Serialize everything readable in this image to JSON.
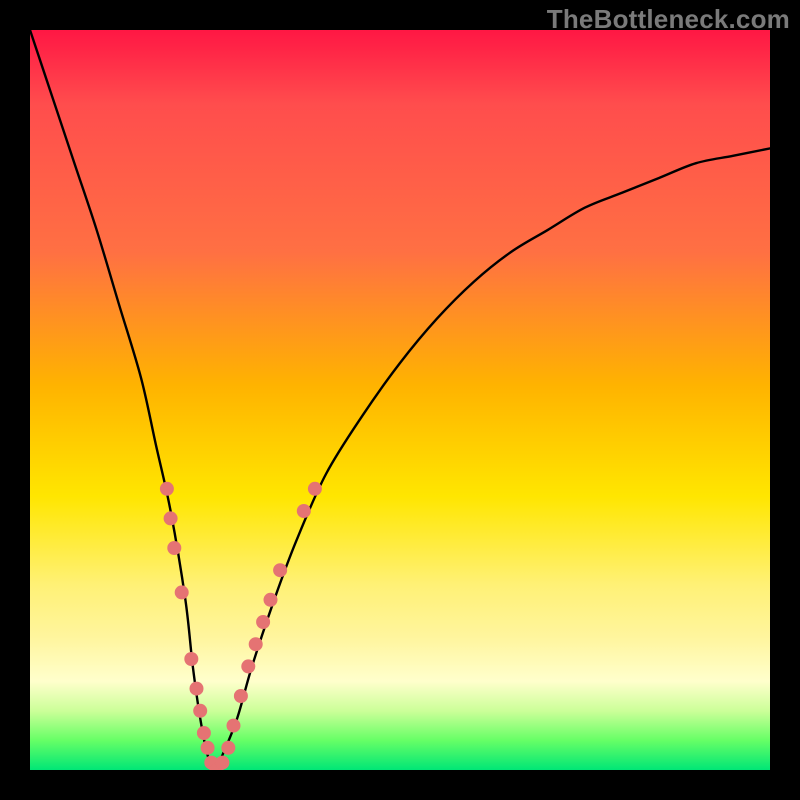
{
  "watermark": "TheBottleneck.com",
  "chart_data": {
    "type": "line",
    "title": "",
    "xlabel": "",
    "ylabel": "",
    "xlim": [
      0,
      100
    ],
    "ylim": [
      0,
      100
    ],
    "grid": false,
    "series": [
      {
        "name": "bottleneck-curve",
        "x": [
          0,
          3,
          6,
          9,
          12,
          15,
          17,
          19,
          21,
          22,
          23,
          24,
          25,
          26,
          28,
          30,
          33,
          36,
          40,
          45,
          50,
          55,
          60,
          65,
          70,
          75,
          80,
          85,
          90,
          95,
          100
        ],
        "values": [
          100,
          91,
          82,
          73,
          63,
          53,
          44,
          35,
          23,
          14,
          7,
          2,
          0,
          2,
          7,
          14,
          23,
          31,
          40,
          48,
          55,
          61,
          66,
          70,
          73,
          76,
          78,
          80,
          82,
          83,
          84
        ],
        "color": "#000000"
      }
    ],
    "markers": {
      "name": "sample-points",
      "color": "#e57373",
      "points": [
        {
          "x": 18.5,
          "y": 38
        },
        {
          "x": 19.0,
          "y": 34
        },
        {
          "x": 19.5,
          "y": 30
        },
        {
          "x": 20.5,
          "y": 24
        },
        {
          "x": 21.8,
          "y": 15
        },
        {
          "x": 22.5,
          "y": 11
        },
        {
          "x": 23.0,
          "y": 8
        },
        {
          "x": 23.5,
          "y": 5
        },
        {
          "x": 24.0,
          "y": 3
        },
        {
          "x": 24.5,
          "y": 1
        },
        {
          "x": 25.2,
          "y": 0
        },
        {
          "x": 26.0,
          "y": 1
        },
        {
          "x": 26.8,
          "y": 3
        },
        {
          "x": 27.5,
          "y": 6
        },
        {
          "x": 28.5,
          "y": 10
        },
        {
          "x": 29.5,
          "y": 14
        },
        {
          "x": 30.5,
          "y": 17
        },
        {
          "x": 31.5,
          "y": 20
        },
        {
          "x": 32.5,
          "y": 23
        },
        {
          "x": 33.8,
          "y": 27
        },
        {
          "x": 37.0,
          "y": 35
        },
        {
          "x": 38.5,
          "y": 38
        }
      ]
    },
    "gradient_stops": [
      {
        "pos": 0.0,
        "color": "#ff1744"
      },
      {
        "pos": 0.1,
        "color": "#ff4d4d"
      },
      {
        "pos": 0.3,
        "color": "#ff7043"
      },
      {
        "pos": 0.48,
        "color": "#ffb300"
      },
      {
        "pos": 0.63,
        "color": "#ffe600"
      },
      {
        "pos": 0.75,
        "color": "#fff176"
      },
      {
        "pos": 0.82,
        "color": "#fff59d"
      },
      {
        "pos": 0.88,
        "color": "#ffffcc"
      },
      {
        "pos": 0.92,
        "color": "#ccff99"
      },
      {
        "pos": 0.96,
        "color": "#66ff66"
      },
      {
        "pos": 1.0,
        "color": "#00e676"
      }
    ]
  }
}
